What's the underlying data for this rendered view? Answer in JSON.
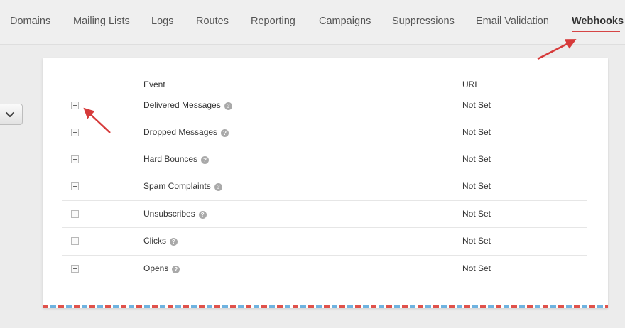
{
  "nav": {
    "items": [
      {
        "label": "Domains"
      },
      {
        "label": "Mailing Lists"
      },
      {
        "label": "Logs"
      },
      {
        "label": "Routes"
      },
      {
        "label": "Reporting"
      },
      {
        "label": "Campaigns"
      },
      {
        "label": "Suppressions"
      },
      {
        "label": "Email Validation"
      },
      {
        "label": "Webhooks"
      }
    ],
    "active": "Webhooks"
  },
  "table": {
    "headers": {
      "event": "Event",
      "url": "URL"
    },
    "rows": [
      {
        "event": "Delivered Messages",
        "url": "Not Set"
      },
      {
        "event": "Dropped Messages",
        "url": "Not Set"
      },
      {
        "event": "Hard Bounces",
        "url": "Not Set"
      },
      {
        "event": "Spam Complaints",
        "url": "Not Set"
      },
      {
        "event": "Unsubscribes",
        "url": "Not Set"
      },
      {
        "event": "Clicks",
        "url": "Not Set"
      },
      {
        "event": "Opens",
        "url": "Not Set"
      }
    ]
  },
  "icons": {
    "help": "question-circle-icon",
    "expand": "plus-square-icon",
    "dropdown": "chevron-down-icon"
  },
  "colors": {
    "accent": "#d64545",
    "annotation_arrow": "#d63a3a",
    "stripe_red": "#e0524b",
    "stripe_blue": "#6fb3e0"
  }
}
